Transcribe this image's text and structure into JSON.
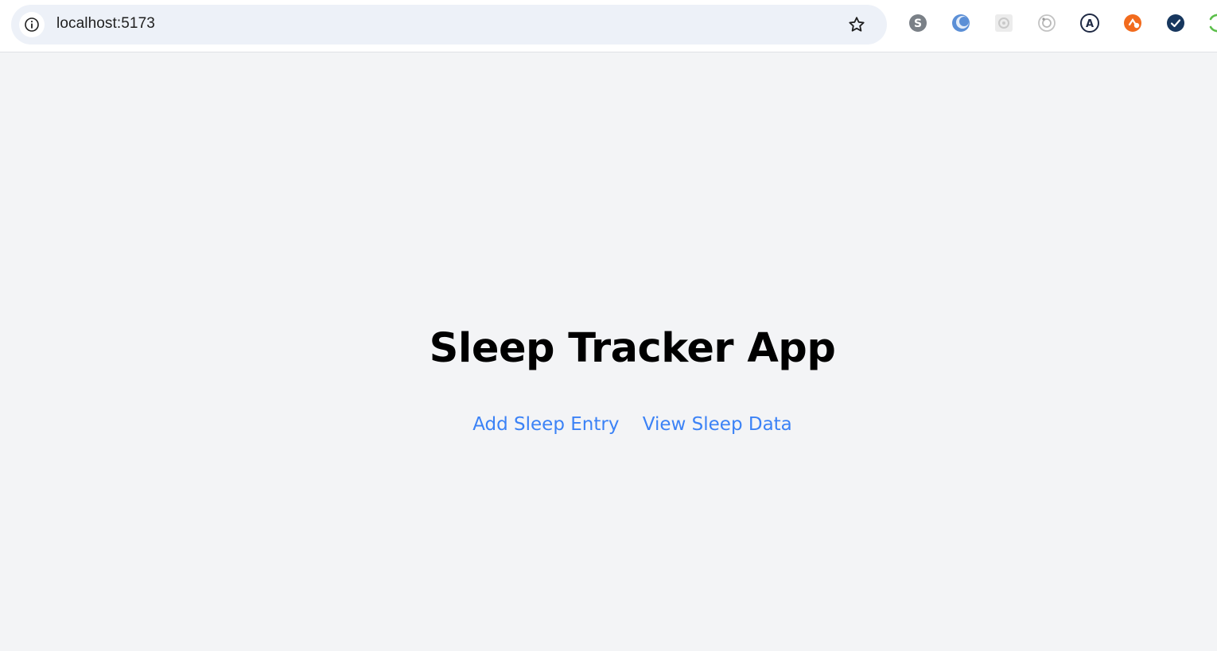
{
  "browser": {
    "url": "localhost:5173",
    "extensions": [
      {
        "icon": "skype-icon",
        "label": "S",
        "color": "#7a8087"
      },
      {
        "icon": "crescent-extension-icon",
        "label": "",
        "color": "#5b8fd6"
      },
      {
        "icon": "gear-extension-icon",
        "label": "",
        "color": "#c9c9c9"
      },
      {
        "icon": "camera-extension-icon",
        "label": "",
        "color": "#b8b8b8"
      },
      {
        "icon": "a-extension-icon",
        "label": "A",
        "color": "#1f2a44"
      },
      {
        "icon": "orange-extension-icon",
        "label": "",
        "color": "#f26b1d"
      },
      {
        "icon": "check-extension-icon",
        "label": "",
        "color": "#17375e"
      },
      {
        "icon": "green-extension-icon",
        "label": "",
        "color": "#5bbf4a"
      }
    ]
  },
  "app": {
    "title": "Sleep Tracker App",
    "nav": {
      "add_entry": "Add Sleep Entry",
      "view_data": "View Sleep Data"
    },
    "colors": {
      "background": "#f3f4f6",
      "link": "#3b82f6",
      "title": "#000000"
    }
  }
}
